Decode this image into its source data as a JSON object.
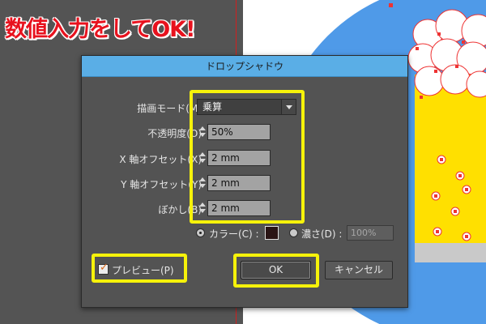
{
  "headline": "数値入力をしてOK!",
  "dialog": {
    "title": "ドロップシャドウ",
    "mode_label": "描画モード(M)",
    "mode_value": "乗算",
    "opacity_label": "不透明度(O)",
    "opacity_value": "50%",
    "x_offset_label": "X 軸オフセット(X)",
    "x_offset_value": "2 mm",
    "y_offset_label": "Y 軸オフセット(Y)",
    "y_offset_value": "2 mm",
    "blur_label": "ぼかし(B)",
    "blur_value": "2 mm",
    "color_label": "カラー(C) :",
    "darkness_label": "濃さ(D) :",
    "darkness_value": "100%",
    "preview_label": "プレビュー(P)",
    "ok_label": "OK",
    "cancel_label": "キャンセル"
  },
  "colors": {
    "highlight": "#f6f20a",
    "titlebar": "#5aaee6",
    "headline": "#e8121e",
    "beer": "#ffe000",
    "circle": "#4f9ae8"
  }
}
